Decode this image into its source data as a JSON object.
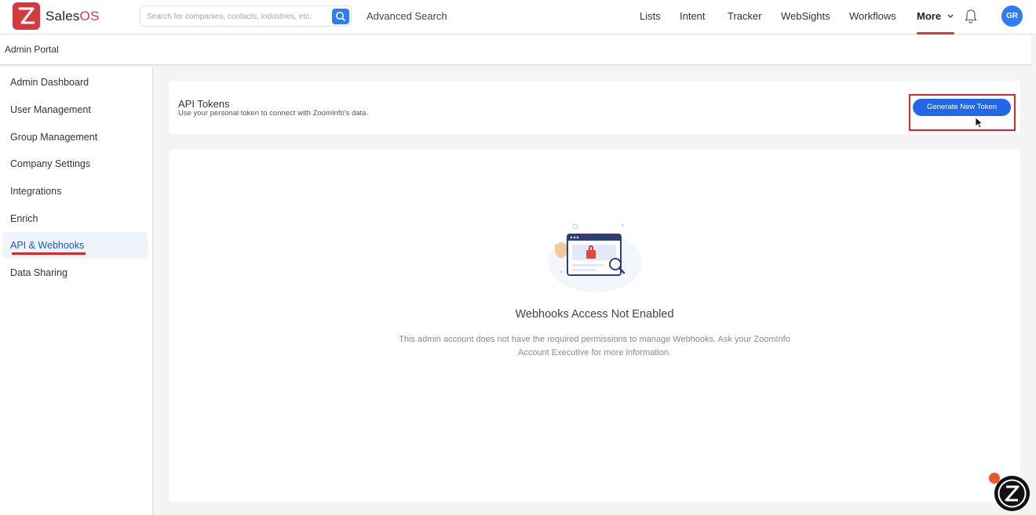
{
  "brand": {
    "name": "Sales",
    "name_suffix": "OS",
    "accent": "#d33a3f"
  },
  "search": {
    "placeholder": "Search for companies, contacts, industries, etc.",
    "advanced_label": "Advanced Search"
  },
  "topnav": {
    "items": [
      {
        "label": "Lists"
      },
      {
        "label": "Intent"
      },
      {
        "label": "Tracker"
      },
      {
        "label": "WebSights"
      },
      {
        "label": "Workflows"
      },
      {
        "label": "More"
      }
    ],
    "avatar_initials": "GR"
  },
  "portal": {
    "title": "Admin Portal"
  },
  "sidebar": {
    "items": [
      {
        "label": "Admin Dashboard"
      },
      {
        "label": "User Management"
      },
      {
        "label": "Group Management"
      },
      {
        "label": "Company Settings"
      },
      {
        "label": "Integrations"
      },
      {
        "label": "Enrich"
      },
      {
        "label": "API & Webhooks",
        "active": true
      },
      {
        "label": "Data Sharing"
      }
    ]
  },
  "api_tokens": {
    "title": "API Tokens",
    "subtitle": "Use your personal token to connect with ZoomInfo's data.",
    "button_label": "Generate New Token"
  },
  "webhooks": {
    "title": "Webhooks Access Not Enabled",
    "message": "This admin account does not have the required permissions to manage Webhooks. Ask your ZoomInfo Account Executive for more information."
  },
  "colors": {
    "primary": "#2168e8",
    "highlight": "#d7262c",
    "active_text": "#1d57c9"
  }
}
